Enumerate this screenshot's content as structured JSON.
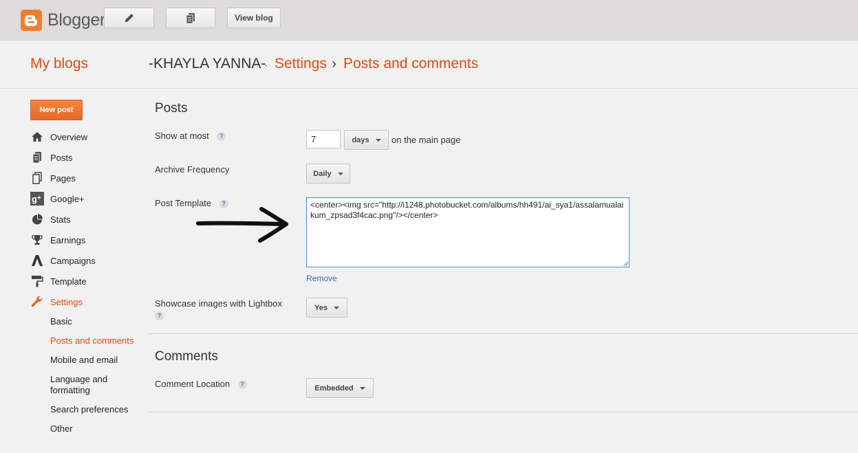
{
  "topbar": {
    "brand": "Blogger",
    "view_blog_label": "View blog"
  },
  "header": {
    "my_blogs": "My blogs",
    "blog_name": "-KHAYLA YANNA-",
    "separator_dot": "·",
    "settings": "Settings",
    "arrow": "›",
    "section": "Posts and comments"
  },
  "sidebar": {
    "new_post": "New post",
    "items": [
      {
        "label": "Overview",
        "icon": "home-icon"
      },
      {
        "label": "Posts",
        "icon": "posts-icon"
      },
      {
        "label": "Pages",
        "icon": "pages-icon"
      },
      {
        "label": "Google+",
        "icon": "google-plus-icon"
      },
      {
        "label": "Stats",
        "icon": "stats-icon"
      },
      {
        "label": "Earnings",
        "icon": "trophy-icon"
      },
      {
        "label": "Campaigns",
        "icon": "campaigns-icon"
      },
      {
        "label": "Template",
        "icon": "paint-roller-icon"
      },
      {
        "label": "Settings",
        "icon": "wrench-icon"
      }
    ],
    "sub_items": [
      {
        "label": "Basic"
      },
      {
        "label": "Posts and comments"
      },
      {
        "label": "Mobile and email"
      },
      {
        "label": "Language and formatting"
      },
      {
        "label": "Search preferences"
      },
      {
        "label": "Other"
      }
    ]
  },
  "posts": {
    "title": "Posts",
    "show_at_most_label": "Show at most",
    "show_at_most_value": "7",
    "show_at_most_unit": "days",
    "show_at_most_suffix": "on the main page",
    "archive_label": "Archive Frequency",
    "archive_value": "Daily",
    "template_label": "Post Template",
    "template_value": "<center><img src=\"http://i1248.photobucket.com/albums/hh491/ai_sya1/assalamualaikum_zpsad3f4cac.png\"/></center>",
    "remove_label": "Remove",
    "lightbox_label": "Showcase images with Lightbox",
    "lightbox_value": "Yes"
  },
  "comments": {
    "title": "Comments",
    "location_label": "Comment Location",
    "location_value": "Embedded"
  },
  "help_glyph": "?",
  "colors": {
    "accent": "#dd4b17",
    "new_post_button": "#ee7a30",
    "link": "#3366bb",
    "focus_border": "#4d90fe"
  }
}
